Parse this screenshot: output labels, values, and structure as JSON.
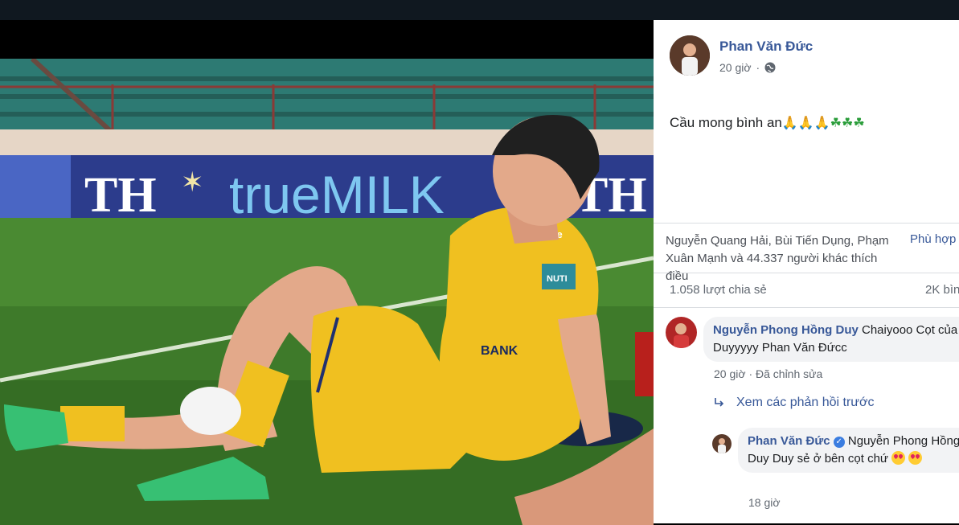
{
  "post": {
    "author": "Phan Văn Đức",
    "time": "20 giờ",
    "text": "Cầu mong bình an",
    "text_emojis": [
      "pray",
      "pray",
      "pray",
      "clover",
      "clover",
      "clover"
    ]
  },
  "reactions": {
    "likes_text": "Nguyễn Quang Hải, Bùi Tiến Dụng, Phạm Xuân Mạnh và 44.337 người khác thích điều",
    "sort_label": "Phù hợp",
    "shares": "1.058 lượt chia sẻ",
    "comments_count": "2K bìn"
  },
  "comments": [
    {
      "author": "Nguyễn Phong Hồng Duy",
      "text": "Chaiyooo Cọt của Duyyyyy Phan Văn Đứcc",
      "time": "20 giờ",
      "edited": "Đã chỉnh sửa"
    }
  ],
  "view_previous_replies": "Xem các phản hồi trước",
  "reply": {
    "author": "Phan Văn Đức",
    "text": "Nguyễn Phong Hồng Duy Duy sẻ ở bên cọt chứ",
    "time": "18 giờ"
  },
  "photo": {
    "banner_left": "TH",
    "banner_main": "trueMILK",
    "banner_right": "TH",
    "shirt_brand": "mitre",
    "sponsor": "NUTI",
    "chest": "BANK"
  },
  "colors": {
    "link": "#385898",
    "grass": "#3e7a2a",
    "banner": "#2c3c8c",
    "jersey": "#f0c020"
  }
}
